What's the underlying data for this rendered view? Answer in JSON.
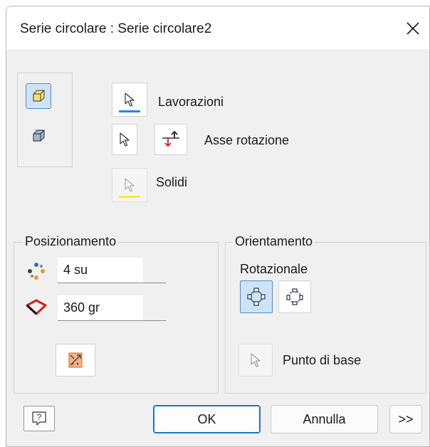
{
  "window": {
    "title": "Serie circolare : Serie circolare2",
    "close_label": "Chiudi"
  },
  "selection": {
    "features_label": "Lavorazioni",
    "axis_label": "Asse rotazione",
    "solids_label": "Solidi",
    "features_underline_color": "#1e88e5",
    "solids_underline_color": "#ffeb3b"
  },
  "placement": {
    "legend": "Posizionamento",
    "count_value": "4 su",
    "angle_value": "360 gr"
  },
  "orientation": {
    "legend": "Orientamento",
    "rotational_label": "Rotazionale",
    "base_point_label": "Punto di base"
  },
  "footer": {
    "help_icon": "?",
    "ok_label": "OK",
    "cancel_label": "Annulla",
    "more_label": ">>"
  },
  "colors": {
    "active_fill": "#cde3f7",
    "active_border": "#4b8fd0",
    "primary_border": "#1f74c8"
  }
}
